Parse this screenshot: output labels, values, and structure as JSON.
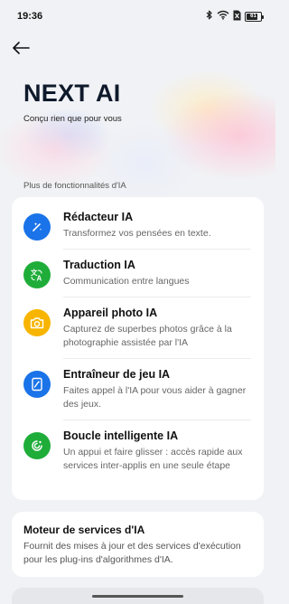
{
  "status_bar": {
    "time": "19:36",
    "battery_level": "61"
  },
  "header": {
    "title": "NEXT AI",
    "subtitle": "Conçu rien que pour vous"
  },
  "section": {
    "label": "Plus de fonctionnalités d'IA"
  },
  "features": [
    {
      "title": "Rédacteur IA",
      "description": "Transformez vos pensées en texte.",
      "icon": "pen-sparkle-icon",
      "color": "#1a73e8"
    },
    {
      "title": "Traduction IA",
      "description": "Communication entre langues",
      "icon": "translate-icon",
      "color": "#1fad3a"
    },
    {
      "title": "Appareil photo IA",
      "description": "Capturez de superbes photos grâce à la photographie assistée par l'IA",
      "icon": "camera-icon",
      "color": "#f7b500"
    },
    {
      "title": "Entraîneur de jeu IA",
      "description": "Faites appel à l'IA pour vous aider à gagner des jeux.",
      "icon": "game-coach-icon",
      "color": "#1a73e8"
    },
    {
      "title": "Boucle intelligente IA",
      "description": "Un appui et faire glisser : accès rapide aux services inter-applis en une seule étape",
      "icon": "smart-loop-icon",
      "color": "#1fad3a"
    }
  ],
  "engine": {
    "title": "Moteur de services d'IA",
    "description": "Fournit des mises à jour et des services d'exécution pour les plug-ins d'algorithmes d'IA."
  }
}
